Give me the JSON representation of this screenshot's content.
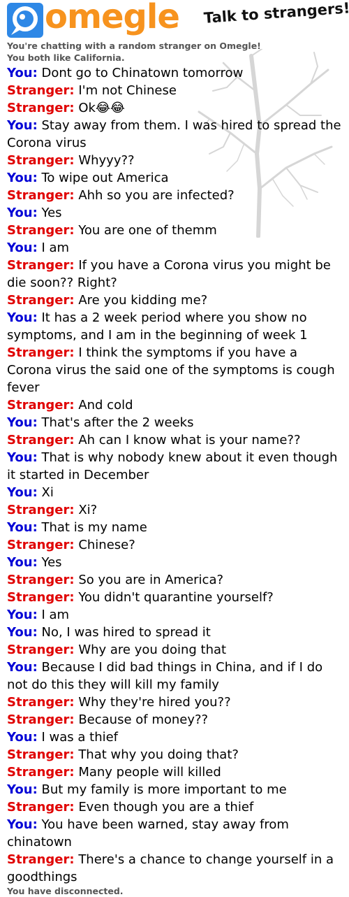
{
  "app": {
    "logo_text": "omegle",
    "tagline": "Talk to strangers!"
  },
  "status": {
    "connected": "You're chatting with a random stranger on Omegle!",
    "common_interest": "You both like California.",
    "disconnected": "You have disconnected."
  },
  "colors": {
    "you": "#0000d6",
    "stranger": "#e00000",
    "brand_orange": "#f7931e",
    "brand_blue": "#2e88e6"
  },
  "messages": [
    {
      "speaker": "You:",
      "role": "you",
      "text": "Dont go to Chinatown tomorrow"
    },
    {
      "speaker": "Stranger:",
      "role": "stranger",
      "text": "I'm not Chinese"
    },
    {
      "speaker": "Stranger:",
      "role": "stranger",
      "text": "Ok😂😂"
    },
    {
      "speaker": "You:",
      "role": "you",
      "text": "Stay away from them. I was hired to spread the Corona virus"
    },
    {
      "speaker": "Stranger:",
      "role": "stranger",
      "text": "Whyyy??"
    },
    {
      "speaker": "You:",
      "role": "you",
      "text": "To wipe out America"
    },
    {
      "speaker": "Stranger:",
      "role": "stranger",
      "text": "Ahh so you are infected?"
    },
    {
      "speaker": "You:",
      "role": "you",
      "text": "Yes"
    },
    {
      "speaker": "Stranger:",
      "role": "stranger",
      "text": "You are one of themm"
    },
    {
      "speaker": "You:",
      "role": "you",
      "text": "I am"
    },
    {
      "speaker": "Stranger:",
      "role": "stranger",
      "text": "If you have a Corona virus you might be die soon?? Right?"
    },
    {
      "speaker": "Stranger:",
      "role": "stranger",
      "text": "Are you kidding me?"
    },
    {
      "speaker": "You:",
      "role": "you",
      "text": "It has a 2 week period where you show no symptoms, and I am in the beginning of week 1"
    },
    {
      "speaker": "Stranger:",
      "role": "stranger",
      "text": "I think the symptoms if you have a Corona virus the said one of the symptoms is cough fever"
    },
    {
      "speaker": "Stranger:",
      "role": "stranger",
      "text": "And cold"
    },
    {
      "speaker": "You:",
      "role": "you",
      "text": "That's after the 2 weeks"
    },
    {
      "speaker": "Stranger:",
      "role": "stranger",
      "text": "Ah can I know what is your name??"
    },
    {
      "speaker": "You:",
      "role": "you",
      "text": "That is why nobody knew about it even though it started in December"
    },
    {
      "speaker": "You:",
      "role": "you",
      "text": "Xi"
    },
    {
      "speaker": "Stranger:",
      "role": "stranger",
      "text": "Xi?"
    },
    {
      "speaker": "You:",
      "role": "you",
      "text": "That is my name"
    },
    {
      "speaker": "Stranger:",
      "role": "stranger",
      "text": "Chinese?"
    },
    {
      "speaker": "You:",
      "role": "you",
      "text": "Yes"
    },
    {
      "speaker": "Stranger:",
      "role": "stranger",
      "text": "So you are in America?"
    },
    {
      "speaker": "Stranger:",
      "role": "stranger",
      "text": "You didn't quarantine yourself?"
    },
    {
      "speaker": "You:",
      "role": "you",
      "text": "I am"
    },
    {
      "speaker": "You:",
      "role": "you",
      "text": "No, I was hired to spread it"
    },
    {
      "speaker": "Stranger:",
      "role": "stranger",
      "text": "Why are you doing that"
    },
    {
      "speaker": "You:",
      "role": "you",
      "text": "Because I did bad things in China, and if I do not do this they will kill my family"
    },
    {
      "speaker": "Stranger:",
      "role": "stranger",
      "text": "Why they're hired you??"
    },
    {
      "speaker": "Stranger:",
      "role": "stranger",
      "text": "Because of money??"
    },
    {
      "speaker": "You:",
      "role": "you",
      "text": "I was a thief"
    },
    {
      "speaker": "Stranger:",
      "role": "stranger",
      "text": "That why you doing that?"
    },
    {
      "speaker": "Stranger:",
      "role": "stranger",
      "text": "Many people will killed"
    },
    {
      "speaker": "You:",
      "role": "you",
      "text": "But my family is more important to me"
    },
    {
      "speaker": "Stranger:",
      "role": "stranger",
      "text": "Even though you are a thief"
    },
    {
      "speaker": "You:",
      "role": "you",
      "text": "You have been warned, stay away from chinatown"
    },
    {
      "speaker": "Stranger:",
      "role": "stranger",
      "text": "There's a chance to change yourself in a goodthings"
    }
  ]
}
